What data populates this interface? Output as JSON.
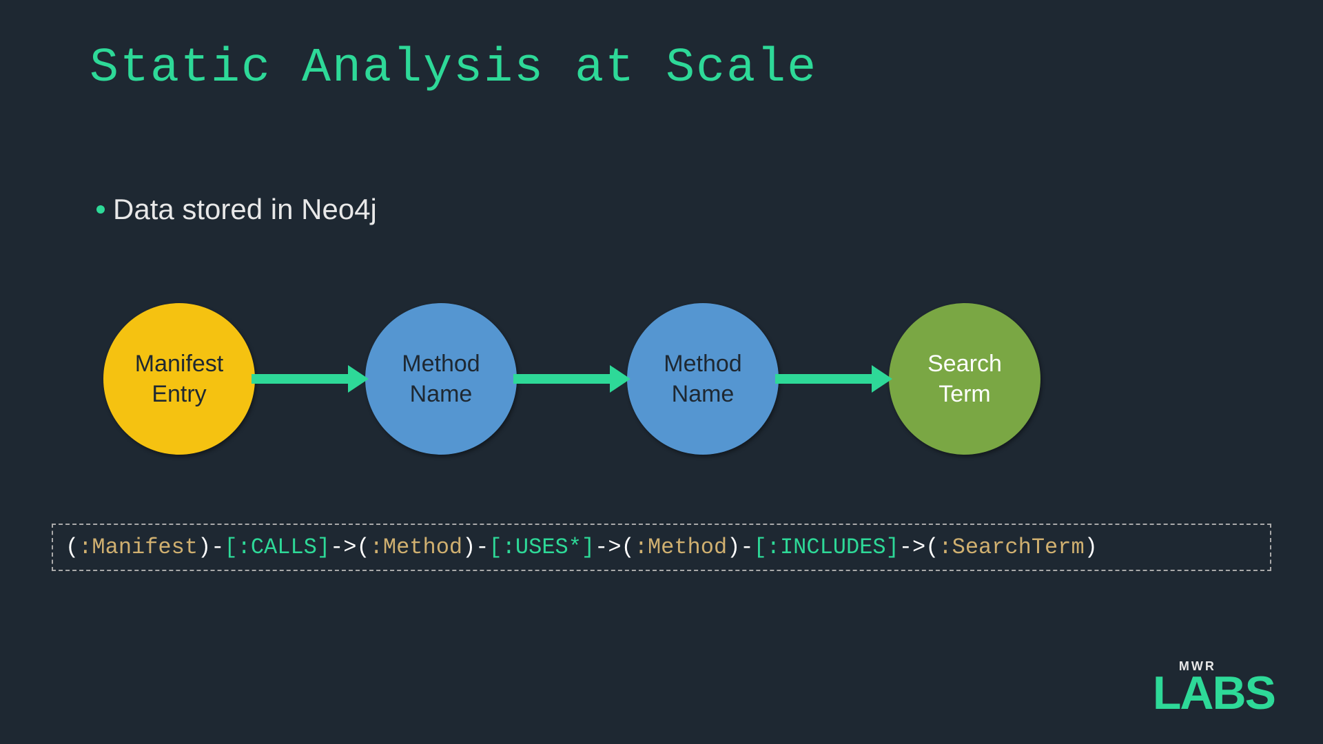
{
  "title": "Static Analysis at Scale",
  "bullet": "Data stored in Neo4j",
  "nodes": [
    {
      "label": "Manifest\nEntry",
      "color": "yellow"
    },
    {
      "label": "Method\nName",
      "color": "blue"
    },
    {
      "label": "Method\nName",
      "color": "blue"
    },
    {
      "label": "Search\nTerm",
      "color": "green"
    }
  ],
  "query": {
    "tokens": [
      {
        "cls": "tok-paren",
        "t": "("
      },
      {
        "cls": "tok-node",
        "t": ":Manifest"
      },
      {
        "cls": "tok-paren",
        "t": ")"
      },
      {
        "cls": "tok-dash",
        "t": "-"
      },
      {
        "cls": "tok-rel",
        "t": "[:CALLS]"
      },
      {
        "cls": "tok-arrow",
        "t": "->"
      },
      {
        "cls": "tok-paren",
        "t": "("
      },
      {
        "cls": "tok-node",
        "t": ":Method"
      },
      {
        "cls": "tok-paren",
        "t": ")"
      },
      {
        "cls": "tok-dash",
        "t": "-"
      },
      {
        "cls": "tok-rel",
        "t": "[:USES*]"
      },
      {
        "cls": "tok-arrow",
        "t": "->"
      },
      {
        "cls": "tok-paren",
        "t": "("
      },
      {
        "cls": "tok-node",
        "t": ":Method"
      },
      {
        "cls": "tok-paren",
        "t": ")"
      },
      {
        "cls": "tok-dash",
        "t": "-"
      },
      {
        "cls": "tok-rel",
        "t": "[:INCLUDES]"
      },
      {
        "cls": "tok-arrow",
        "t": "->"
      },
      {
        "cls": "tok-paren",
        "t": "("
      },
      {
        "cls": "tok-node",
        "t": ":SearchTerm"
      },
      {
        "cls": "tok-paren",
        "t": ")"
      }
    ]
  },
  "logo": {
    "mwr": "MWR",
    "labs": "LABS"
  }
}
